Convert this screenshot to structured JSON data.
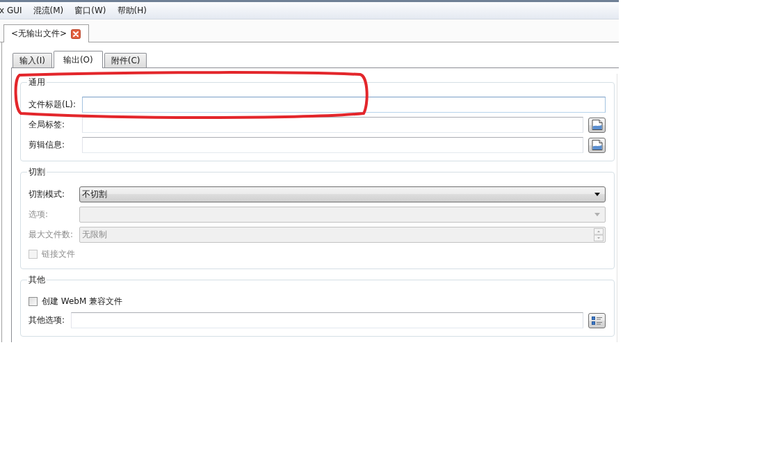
{
  "menu_bar": {
    "items": [
      "x GUI",
      "混流(M)",
      "窗口(W)",
      "帮助(H)"
    ]
  },
  "document_tabs": [
    {
      "label": "<无输出文件>",
      "selected": true
    }
  ],
  "tabs": [
    {
      "label": "输入(I)",
      "selected": false
    },
    {
      "label": "输出(O)",
      "selected": true
    },
    {
      "label": "附件(C)",
      "selected": false
    }
  ],
  "groups": [
    {
      "title": "通用",
      "rows": [
        {
          "kind": "field",
          "label": "文件标题(L):",
          "focused": true,
          "disabled": false
        },
        {
          "kind": "field_browse",
          "label": "全局标签:",
          "focused": false,
          "disabled": false
        },
        {
          "kind": "field_browse",
          "label": "剪辑信息:",
          "focused": false,
          "disabled": false
        }
      ]
    },
    {
      "title": "切割",
      "rows": [
        {
          "kind": "combo",
          "label": "切割模式:",
          "value": "不切割",
          "disabled": false
        },
        {
          "kind": "combo",
          "label": "选项:",
          "disabled": true
        },
        {
          "kind": "spin",
          "label": "最大文件数:",
          "value": "无限制",
          "disabled": true
        },
        {
          "kind": "checkbox",
          "label": "链接文件",
          "checked": false,
          "disabled": true
        }
      ]
    },
    {
      "title": "其他",
      "rows": [
        {
          "kind": "checkbox",
          "label": "创建 WebM 兼容文件",
          "checked": false,
          "disabled": false
        },
        {
          "kind": "field_options",
          "label": "其他选项:",
          "focused": false,
          "disabled": false
        }
      ]
    }
  ]
}
